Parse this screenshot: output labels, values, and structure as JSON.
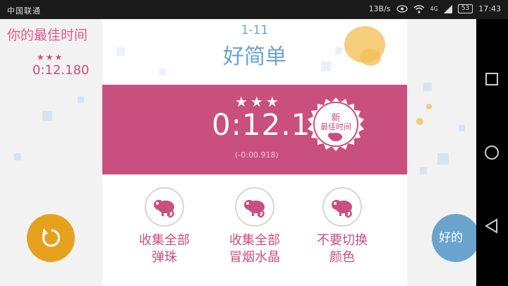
{
  "status_bar": {
    "carrier": "中国联通",
    "network_speed": "13B/s",
    "signal_type": "4G",
    "battery": "53",
    "time": "17:43"
  },
  "best_time": {
    "title": "你的最佳时间",
    "stars": "★★★",
    "value": "0:12.180"
  },
  "level": {
    "number": "1-11",
    "name": "好简单"
  },
  "result": {
    "stars": "★★★",
    "time": "0:12.180",
    "diff": "(-0:00.918)",
    "badge_new": "新",
    "badge_label": "最佳时间"
  },
  "goals": [
    {
      "line1": "收集全部",
      "line2": "弹珠"
    },
    {
      "line1": "收集全部",
      "line2": "冒烟水晶"
    },
    {
      "line1": "不要切换",
      "line2": "颜色"
    }
  ],
  "buttons": {
    "ok_label": "好的"
  },
  "colors": {
    "accent_pink": "#c94f7e",
    "title_blue": "#6aa4cc",
    "retry_orange": "#e6a21e"
  }
}
